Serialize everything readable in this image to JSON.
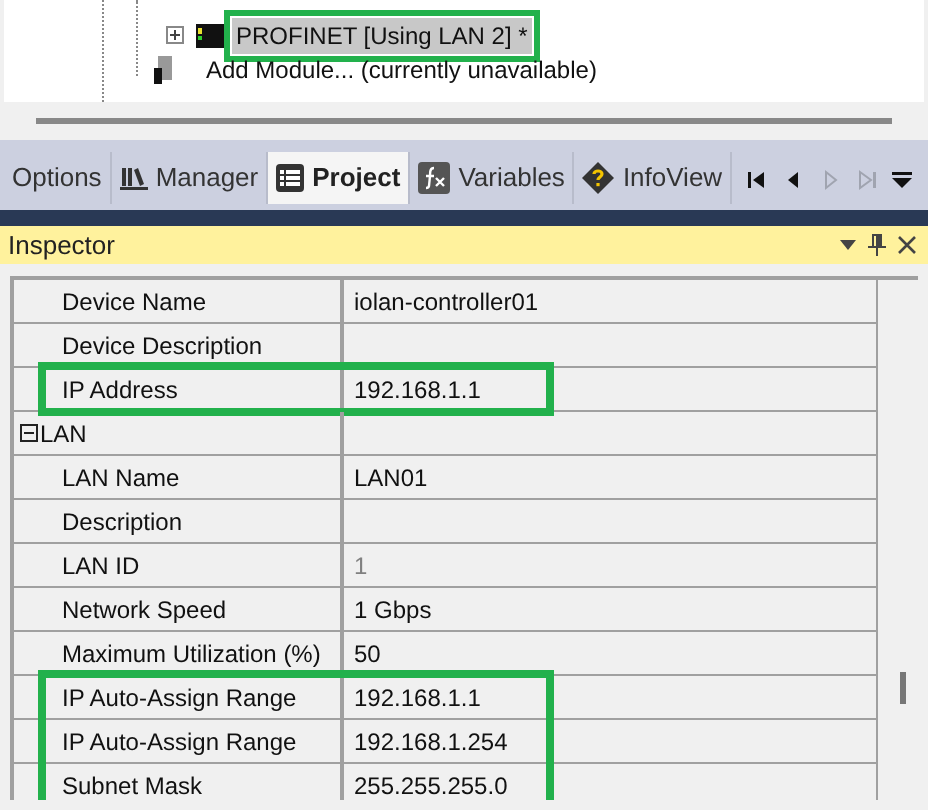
{
  "tree": {
    "items": [
      {
        "label": "PROFINET [Using LAN 2] *",
        "selected": true,
        "highlighted": true
      },
      {
        "label": "Add Module... (currently unavailable)",
        "selected": false,
        "highlighted": false
      }
    ]
  },
  "tabs": [
    {
      "label": "Options",
      "selected": false
    },
    {
      "label": "Manager",
      "selected": false
    },
    {
      "label": "Project",
      "selected": true
    },
    {
      "label": "Variables",
      "selected": false
    },
    {
      "label": "InfoView",
      "selected": false
    }
  ],
  "tab_nav": [
    {
      "kind": "first",
      "disabled": false
    },
    {
      "kind": "prev",
      "disabled": false
    },
    {
      "kind": "next",
      "disabled": true
    },
    {
      "kind": "last",
      "disabled": true
    }
  ],
  "inspector": {
    "title": "Inspector",
    "properties": [
      {
        "kind": "property",
        "name": "Device Name",
        "value": "iolan-controller01",
        "highlighted": false
      },
      {
        "kind": "property",
        "name": "Device Description",
        "highlighted": false
      },
      {
        "kind": "property",
        "name": "IP Address",
        "value": "192.168.1.1",
        "highlighted": true
      },
      {
        "kind": "category",
        "name": "LAN",
        "expanded": true,
        "highlighted": false
      },
      {
        "kind": "property",
        "name": "LAN Name",
        "value": "LAN01",
        "highlighted": false
      },
      {
        "kind": "property",
        "name": "Description",
        "highlighted": false
      },
      {
        "kind": "property",
        "name": "LAN ID",
        "value": "1",
        "readonly": true,
        "highlighted": false
      },
      {
        "kind": "property",
        "name": "Network Speed",
        "value": "1 Gbps",
        "highlighted": false
      },
      {
        "kind": "property",
        "name": "Maximum Utilization (%)",
        "value": "50",
        "highlighted": false
      },
      {
        "kind": "property",
        "name": "IP Auto-Assign Range",
        "value": "192.168.1.1",
        "highlighted": true
      },
      {
        "kind": "property",
        "name": "IP Auto-Assign Range",
        "value": "192.168.1.254",
        "highlighted": true
      },
      {
        "kind": "property",
        "name": "Subnet Mask",
        "value": "255.255.255.0",
        "highlighted": true
      }
    ]
  }
}
